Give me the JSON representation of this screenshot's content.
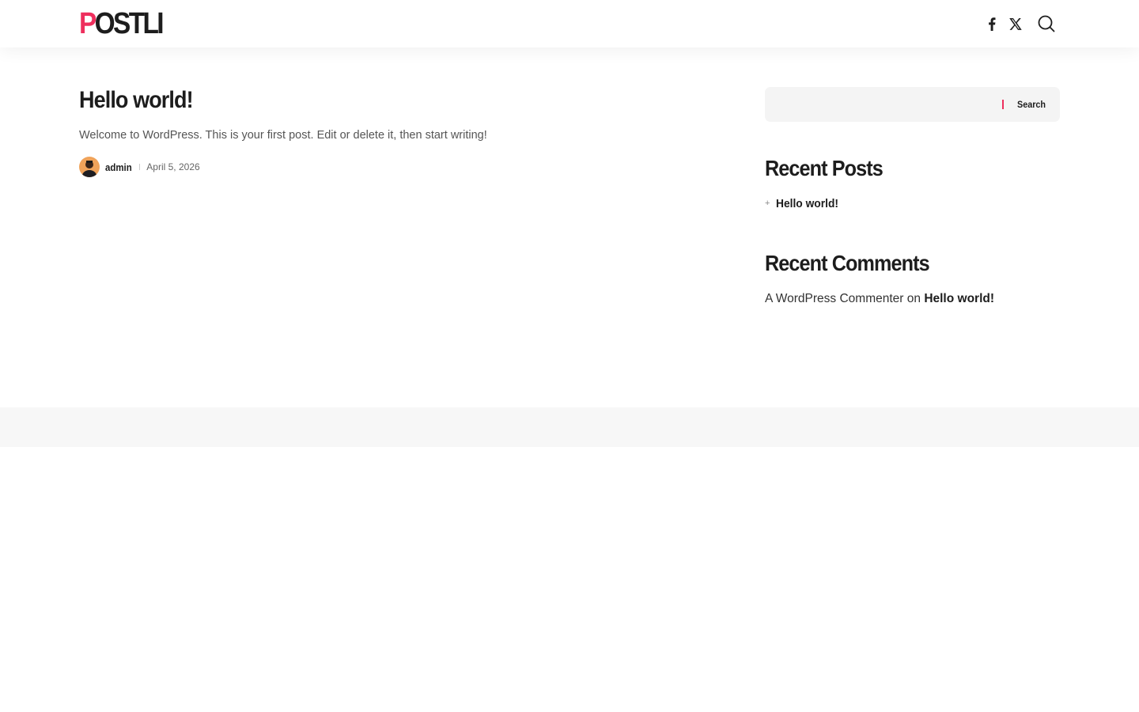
{
  "header": {
    "logo_first": "P",
    "logo_rest": "OSTLI",
    "icons": [
      "facebook-icon",
      "x-twitter-icon",
      "search-icon"
    ],
    "accent_color": "#ee2f5d"
  },
  "post": {
    "title": "Hello world!",
    "excerpt": "Welcome to WordPress. This is your first post. Edit or delete it, then start writing!",
    "author": "admin",
    "date": "April 5, 2026"
  },
  "sidebar": {
    "search": {
      "placeholder": "",
      "button_label": "Search"
    },
    "recent_posts": {
      "title": "Recent Posts",
      "items": [
        {
          "label": "Hello world!"
        }
      ]
    },
    "recent_comments": {
      "title": "Recent Comments",
      "items": [
        {
          "author": "A WordPress Commenter",
          "connector": "on",
          "post": "Hello world!"
        }
      ]
    }
  }
}
